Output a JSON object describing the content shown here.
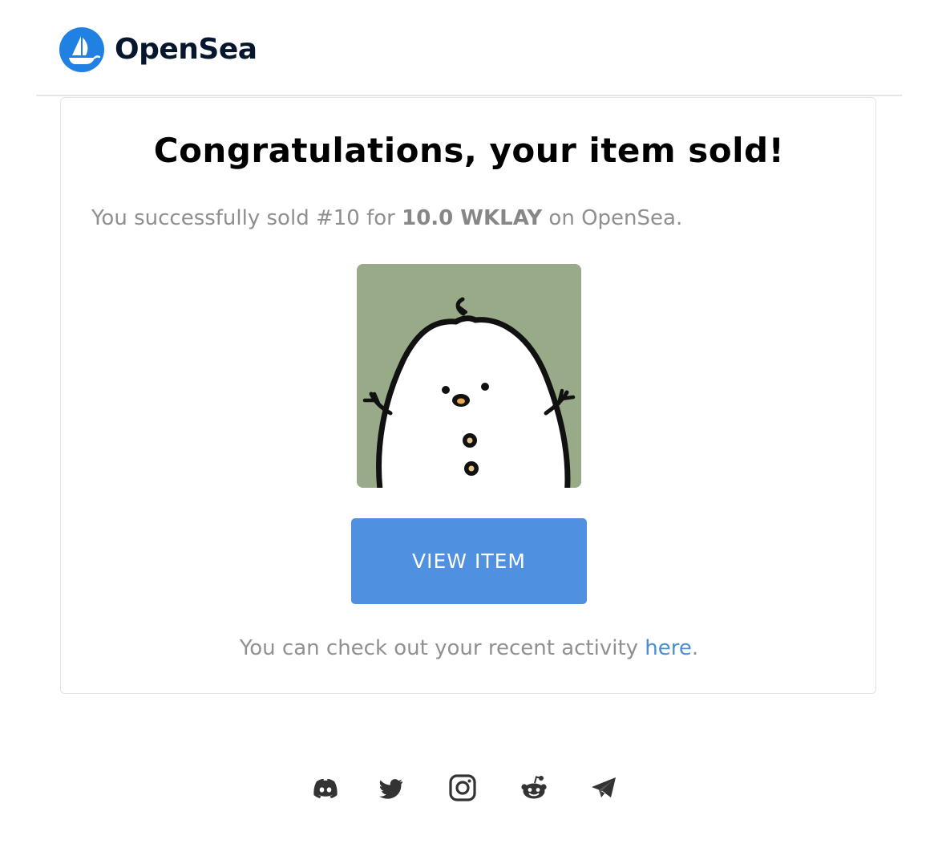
{
  "header": {
    "brand": "OpenSea",
    "brand_color": "#2081e2"
  },
  "card": {
    "title": "Congratulations, your item sold!",
    "message": {
      "prefix": "You successfully sold #10 for ",
      "amount": "10.0 WKLAY",
      "suffix": " on OpenSea."
    },
    "item_image": {
      "icon": "nft-item-image",
      "background": "#98aa88"
    },
    "view_button": {
      "label": "VIEW ITEM",
      "color": "#4f90e1"
    },
    "activity_note": {
      "prefix": "You can check out your recent activity ",
      "link": "here",
      "suffix": "."
    }
  },
  "footer": {
    "social": [
      {
        "name": "discord-icon"
      },
      {
        "name": "twitter-icon"
      },
      {
        "name": "instagram-icon"
      },
      {
        "name": "reddit-icon"
      },
      {
        "name": "telegram-icon"
      }
    ],
    "icon_color": "#333333"
  }
}
